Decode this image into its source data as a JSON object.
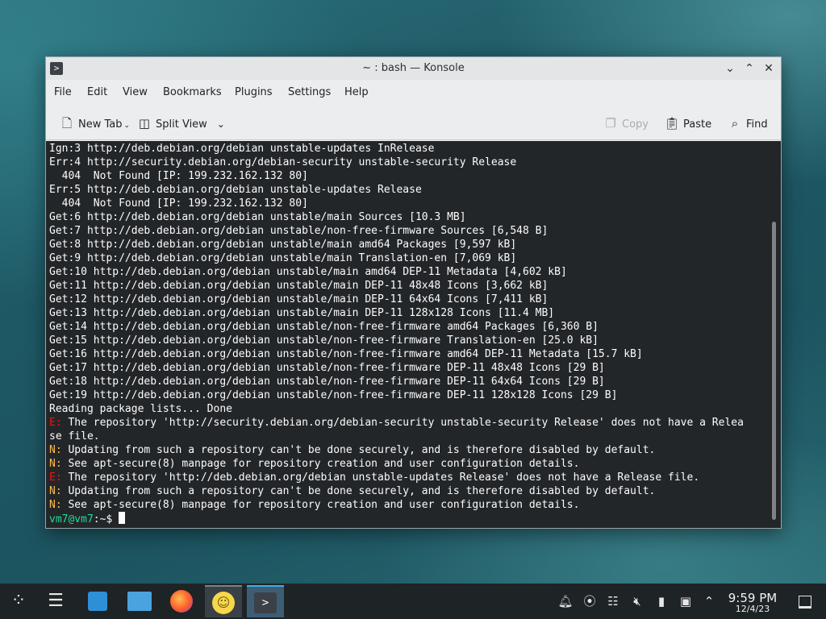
{
  "window": {
    "title": "~ : bash — Konsole",
    "buttons": {
      "minimize": "⌄",
      "maximize": "⌃",
      "close": "✕"
    }
  },
  "menu": [
    "File",
    "Edit",
    "View",
    "Bookmarks",
    "Plugins",
    "Settings",
    "Help"
  ],
  "toolbar": {
    "new_tab": "New Tab",
    "split_view": "Split View",
    "copy": "Copy",
    "paste": "Paste",
    "find": "Find"
  },
  "terminal": {
    "lines": [
      {
        "prefix": "",
        "text": "Ign:3 http://deb.debian.org/debian unstable-updates InRelease"
      },
      {
        "prefix": "",
        "text": "Err:4 http://security.debian.org/debian-security unstable-security Release"
      },
      {
        "prefix": "",
        "text": "  404  Not Found [IP: 199.232.162.132 80]"
      },
      {
        "prefix": "",
        "text": "Err:5 http://deb.debian.org/debian unstable-updates Release"
      },
      {
        "prefix": "",
        "text": "  404  Not Found [IP: 199.232.162.132 80]"
      },
      {
        "prefix": "",
        "text": "Get:6 http://deb.debian.org/debian unstable/main Sources [10.3 MB]"
      },
      {
        "prefix": "",
        "text": "Get:7 http://deb.debian.org/debian unstable/non-free-firmware Sources [6,548 B]"
      },
      {
        "prefix": "",
        "text": "Get:8 http://deb.debian.org/debian unstable/main amd64 Packages [9,597 kB]"
      },
      {
        "prefix": "",
        "text": "Get:9 http://deb.debian.org/debian unstable/main Translation-en [7,069 kB]"
      },
      {
        "prefix": "",
        "text": "Get:10 http://deb.debian.org/debian unstable/main amd64 DEP-11 Metadata [4,602 kB]"
      },
      {
        "prefix": "",
        "text": "Get:11 http://deb.debian.org/debian unstable/main DEP-11 48x48 Icons [3,662 kB]"
      },
      {
        "prefix": "",
        "text": "Get:12 http://deb.debian.org/debian unstable/main DEP-11 64x64 Icons [7,411 kB]"
      },
      {
        "prefix": "",
        "text": "Get:13 http://deb.debian.org/debian unstable/main DEP-11 128x128 Icons [11.4 MB]"
      },
      {
        "prefix": "",
        "text": "Get:14 http://deb.debian.org/debian unstable/non-free-firmware amd64 Packages [6,360 B]"
      },
      {
        "prefix": "",
        "text": "Get:15 http://deb.debian.org/debian unstable/non-free-firmware Translation-en [25.0 kB]"
      },
      {
        "prefix": "",
        "text": "Get:16 http://deb.debian.org/debian unstable/non-free-firmware amd64 DEP-11 Metadata [15.7 kB]"
      },
      {
        "prefix": "",
        "text": "Get:17 http://deb.debian.org/debian unstable/non-free-firmware DEP-11 48x48 Icons [29 B]"
      },
      {
        "prefix": "",
        "text": "Get:18 http://deb.debian.org/debian unstable/non-free-firmware DEP-11 64x64 Icons [29 B]"
      },
      {
        "prefix": "",
        "text": "Get:19 http://deb.debian.org/debian unstable/non-free-firmware DEP-11 128x128 Icons [29 B]"
      },
      {
        "prefix": "",
        "text": "Reading package lists... Done"
      },
      {
        "prefix": "E:",
        "text": " The repository 'http://security.debian.org/debian-security unstable-security Release' does not have a Relea"
      },
      {
        "prefix": "",
        "text": "se file."
      },
      {
        "prefix": "N:",
        "text": " Updating from such a repository can't be done securely, and is therefore disabled by default."
      },
      {
        "prefix": "N:",
        "text": " See apt-secure(8) manpage for repository creation and user configuration details."
      },
      {
        "prefix": "E:",
        "text": " The repository 'http://deb.debian.org/debian unstable-updates Release' does not have a Release file."
      },
      {
        "prefix": "N:",
        "text": " Updating from such a repository can't be done securely, and is therefore disabled by default."
      },
      {
        "prefix": "N:",
        "text": " See apt-secure(8) manpage for repository creation and user configuration details."
      }
    ],
    "prompt_user": "vm7@vm7",
    "prompt_rest": ":~$ "
  },
  "taskbar": {
    "clock_time": "9:59 PM",
    "clock_date": "12/4/23"
  },
  "colors": {
    "terminal_bg": "#232629",
    "error_prefix": "#ed1515",
    "notice_prefix": "#fdbc4b",
    "prompt_user": "#1cdc9a",
    "accent": "#3daee9"
  },
  "icons": {
    "app": "terminal-icon",
    "launcher": "kde-logo-icon",
    "tray": [
      "notification-bell-icon",
      "network-icon",
      "clipboard-icon",
      "volume-muted-icon",
      "usb-drive-icon",
      "display-icon",
      "tray-expand-icon"
    ]
  }
}
